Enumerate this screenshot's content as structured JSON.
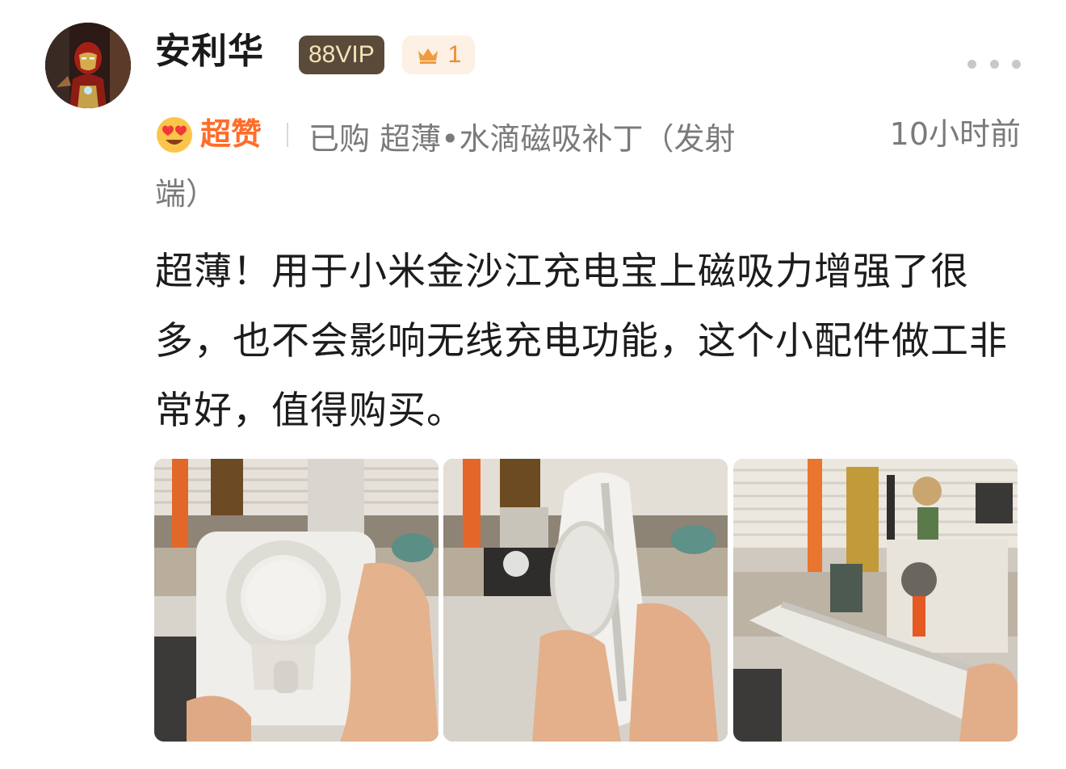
{
  "user": {
    "name": "安利华",
    "vip_label": "88VIP",
    "level": "1",
    "avatar_icon": "iron-man-avatar"
  },
  "review": {
    "rating_label": "超赞",
    "rating_icon": "heart-eyes-emoji-icon",
    "purchase_line_1": "已购 超薄•水滴磁吸补丁（发射",
    "purchase_line_2": "端）",
    "timestamp": "10小时前",
    "body": "超薄！用于小米金沙江充电宝上磁吸力增强了很多，也不会影响无线充电功能，这个小配件做工非常好，值得购买。"
  },
  "photos": [
    {
      "icon": "power-bank-front-photo"
    },
    {
      "icon": "power-bank-side-photo"
    },
    {
      "icon": "power-bank-thickness-photo"
    }
  ],
  "colors": {
    "rating_orange": "#ff6d2a",
    "level_orange": "#f08a2b",
    "vip_bg": "#5a4a3a",
    "vip_text": "#f6e2b8",
    "meta_gray": "#7a7a7a"
  }
}
